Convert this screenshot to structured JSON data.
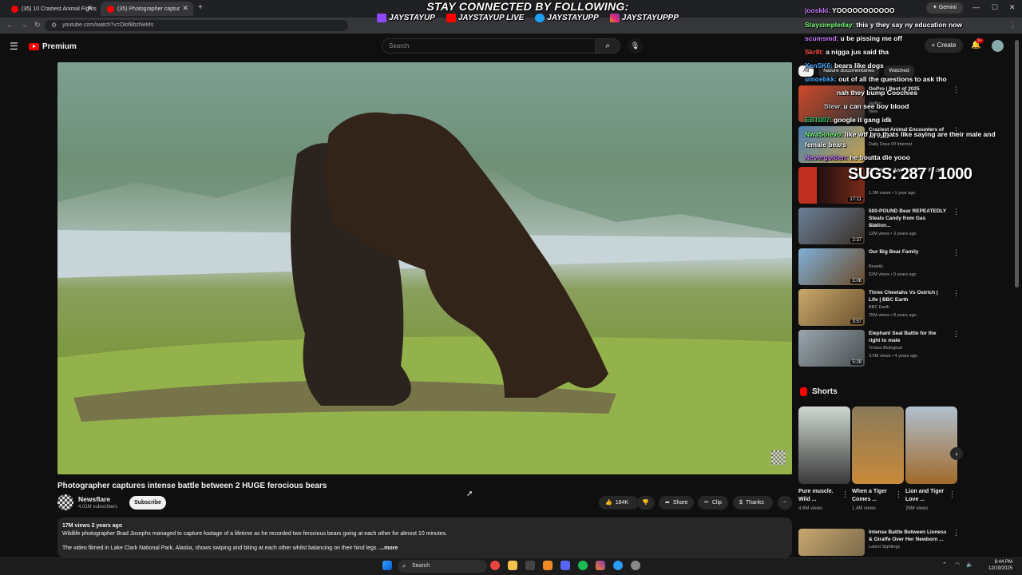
{
  "browser": {
    "tabs": [
      {
        "label": "(35) 10 Craziest Animal Fights"
      },
      {
        "label": "(35) Photographer captur"
      }
    ],
    "url": "youtube.com/watch?v=Olof8bzNeMs",
    "gemini_label": "Gemini"
  },
  "banner": {
    "title": "STAY CONNECTED BY FOLLOWING:",
    "twitch": "JAYSTAYUP",
    "youtube": "JAYSTAYUP LIVE",
    "twitter": "JAYSTAYUPP",
    "instagram": "JAYSTAYUPPP"
  },
  "youtube": {
    "logo_text": "Premium",
    "search_placeholder": "Search",
    "create_label": "Create",
    "notif_count": "9+"
  },
  "video": {
    "title": "Photographer captures intense battle between 2 HUGE ferocious bears",
    "channel": "Newsflare",
    "subscribers": "4.01M subscribers",
    "subscribe_label": "Subscribe",
    "likes": "184K",
    "share_label": "Share",
    "clip_label": "Clip",
    "thanks_label": "Thanks",
    "views_date": "17M views  2 years ago",
    "description_1": "Wildlife photographer Brad Josephs managed to capture footage of a lifetime as he recorded two ferocious bears going at each other for almost 10 minutes.",
    "description_2": "The video filmed in Lake Clark National Park, Alaska, shows swiping and biting at each other whilst balancing on their hind legs.",
    "more_label": "...more"
  },
  "chips": [
    "All",
    "Nature documentaries",
    "Watched"
  ],
  "recommendations": [
    {
      "title": "GoPro | Best of 2025",
      "channel": "GoPro",
      "meta": "New",
      "duration": ""
    },
    {
      "title": "Craziest Animal Encounters of All Time",
      "channel": "Daily Dose Of Internet",
      "meta": "",
      "duration": ""
    },
    {
      "title": "Deadliest Animals (Fast Facts)",
      "channel": "",
      "meta": "1.3M views • 1 year ago",
      "duration": "17:11"
    },
    {
      "title": "500-POUND Bear REPEATEDLY Steals Candy from Gas Station...",
      "channel": "A&E",
      "meta": "12M views • 3 years ago",
      "duration": "2:37"
    },
    {
      "title": "Our Big Bear Family",
      "channel": "Beastly",
      "meta": "52M views • 9 years ago",
      "duration": "5:06"
    },
    {
      "title": "Three Cheetahs Vs Ostrich | Life | BBC Earth",
      "channel": "BBC Earth",
      "meta": "25M views • 8 years ago",
      "duration": "3:57"
    },
    {
      "title": "Elephant Seal Battle for the right to mate",
      "channel": "Tristan Biological",
      "meta": "3.6M views • 4 years ago",
      "duration": "5:28"
    }
  ],
  "shorts": {
    "header": "Shorts",
    "items": [
      {
        "title": "Pure muscle. Wild ...",
        "views": "4.6M views"
      },
      {
        "title": "When a Tiger Comes ...",
        "views": "1.4M views"
      },
      {
        "title": "Lion and Tiger Love ...",
        "views": "26M views"
      }
    ]
  },
  "bottom_rec": {
    "title": "Intense Battle Between Lioness & Giraffe Over Her Newborn ...",
    "channel": "Latest Sightings"
  },
  "chat": [
    {
      "name": "jooskki:",
      "msg": "YOOOOOOOOOOO",
      "color": "#c77dff"
    },
    {
      "name": "Staysimpleday:",
      "msg": "this y they say ny education now",
      "color": "#7cfc7c"
    },
    {
      "name": "scumsmd:",
      "msg": "u be pissing me off",
      "color": "#c77dff"
    },
    {
      "name": "Skr8t:",
      "msg": "a nigga jus said tha",
      "color": "#ff4d4d"
    },
    {
      "name": "XenSK6:",
      "msg": "bears like dogs",
      "color": "#4da6ff"
    },
    {
      "name": "umoebkk:",
      "msg": "out of all the questions to ask tho",
      "color": "#4da6ff"
    },
    {
      "name": "",
      "msg": "nah they bump Coochies",
      "color": "#ff4d4d"
    },
    {
      "name": "Stew:",
      "msg": "u can see boy blood",
      "color": "#cccccc"
    },
    {
      "name": "EBT007:",
      "msg": "google it gang idk",
      "color": "#2ecc71"
    },
    {
      "name": "NwaSolevo:",
      "msg": "like wtf bro thats like saying are their male and female bears",
      "color": "#7cfc7c"
    },
    {
      "name": "Nevergolden:",
      "msg": "he boutta die yooo",
      "color": "#c77dff"
    }
  ],
  "sugs": "SUGS: 287 / 1000",
  "taskbar": {
    "search": "Search",
    "time": "8:44 PM",
    "date": "12/19/2025"
  }
}
